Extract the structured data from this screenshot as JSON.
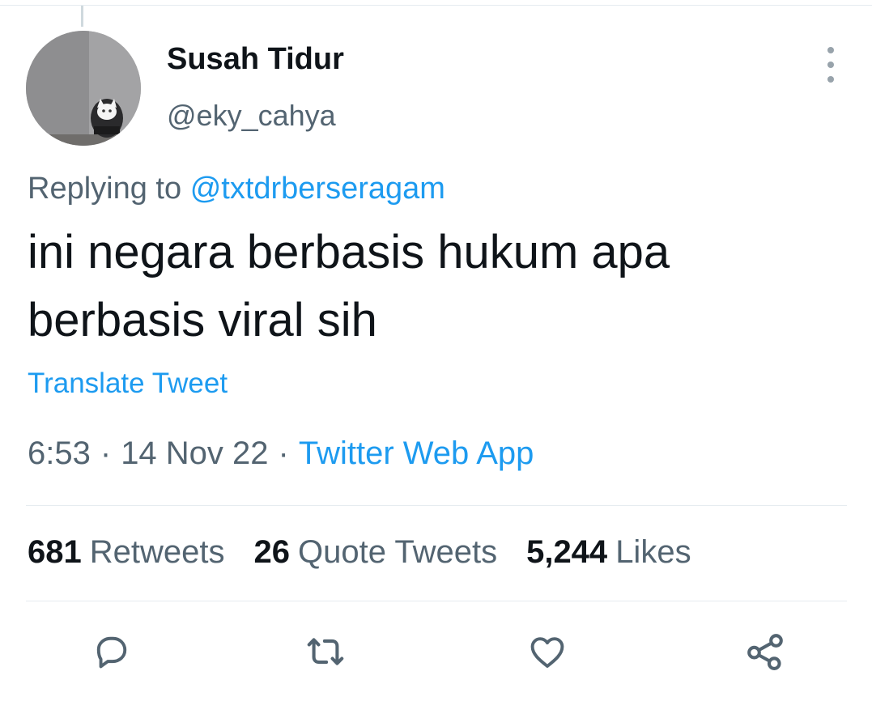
{
  "user": {
    "display_name": "Susah Tidur",
    "handle": "@eky_cahya"
  },
  "reply": {
    "prefix": "Replying to",
    "mention": "@txtdrberseragam"
  },
  "tweet": {
    "text_line_1": "ini negara berbasis hukum apa",
    "text_line_2": "berbasis viral sih",
    "translate_label": "Translate Tweet"
  },
  "meta": {
    "time": "6:53",
    "separator": "·",
    "date": "14 Nov 22",
    "source": "Twitter Web App"
  },
  "stats": {
    "retweets_count": "681",
    "retweets_label": "Retweets",
    "quotes_count": "26",
    "quotes_label": "Quote Tweets",
    "likes_count": "5,244",
    "likes_label": "Likes"
  },
  "actions": {
    "icons": [
      "reply-icon",
      "retweet-icon",
      "like-icon",
      "share-icon"
    ]
  },
  "colors": {
    "accent": "#1d9bf0",
    "text_primary": "#0f1419",
    "text_secondary": "#536471",
    "divider": "#e6ecf0",
    "icon": "#536471"
  }
}
